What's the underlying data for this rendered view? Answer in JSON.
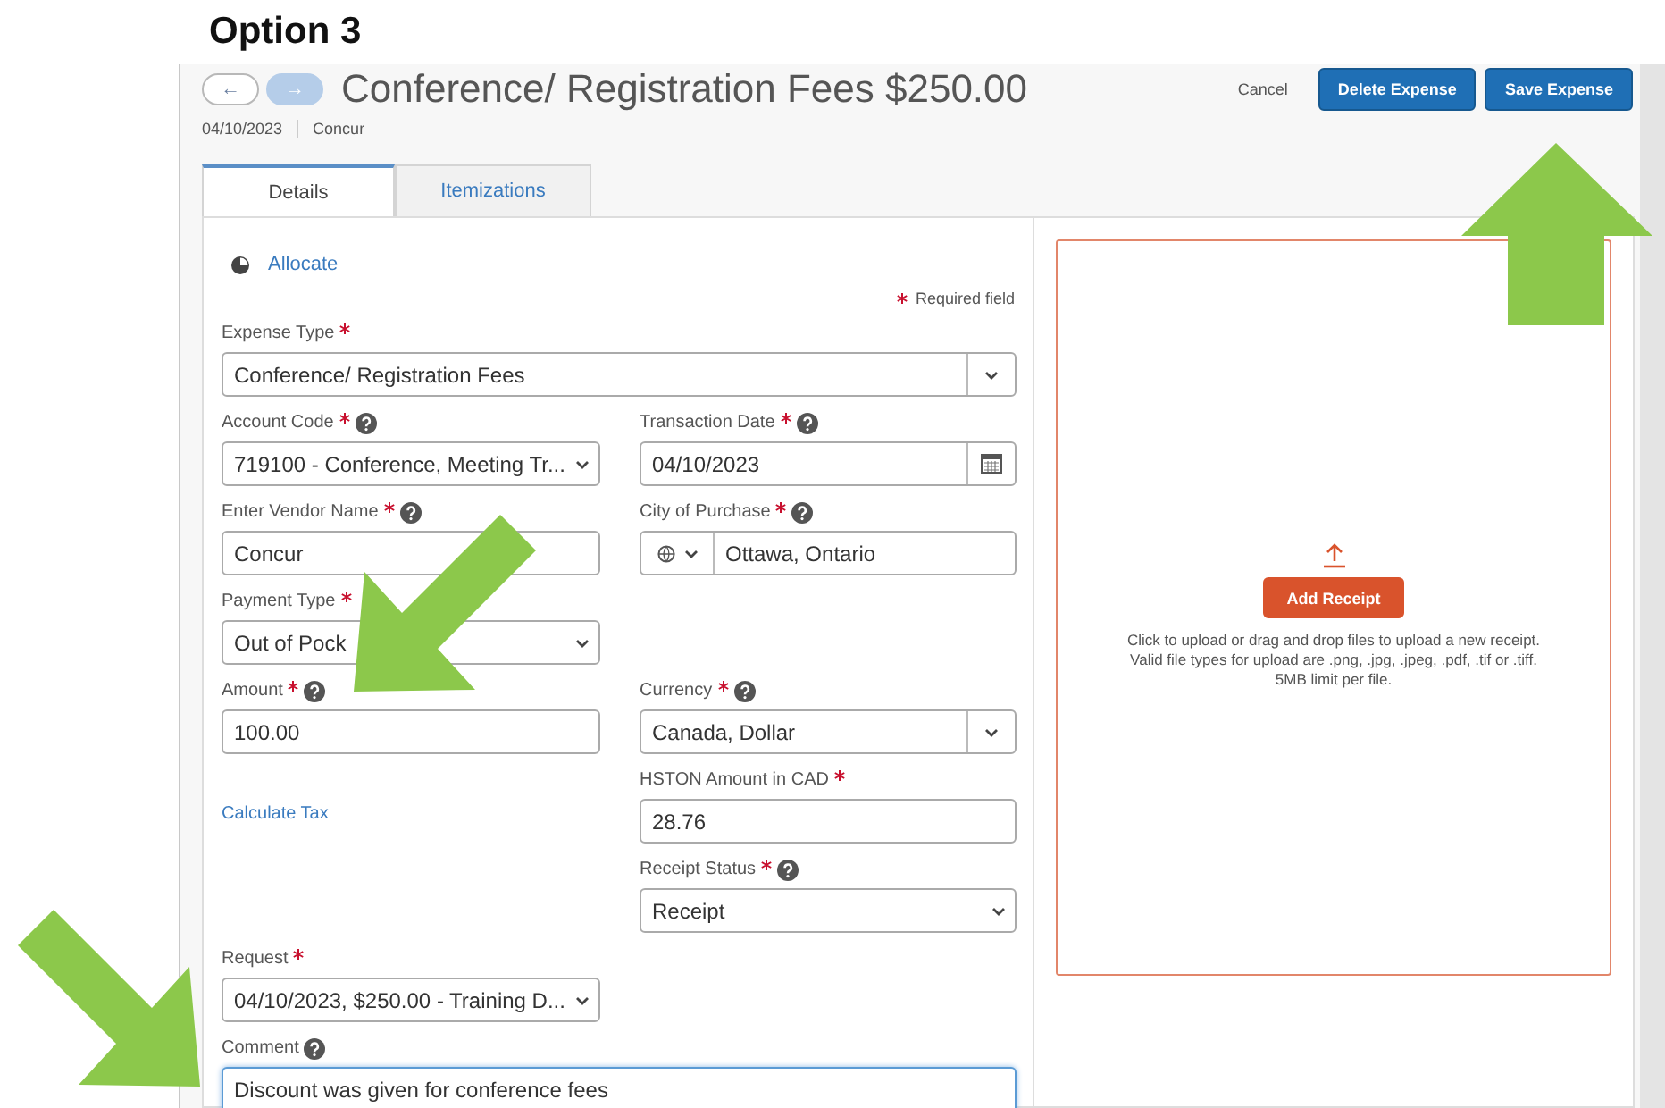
{
  "caption": "Option 3",
  "header": {
    "nav": [
      {
        "label": "←",
        "disabled": false
      },
      {
        "label": "→",
        "disabled": true
      }
    ],
    "title": "Conference/ Registration Fees $250.00",
    "date": "04/10/2023",
    "vendor": "Concur",
    "actions": [
      {
        "label": "Cancel",
        "kind": "link"
      },
      {
        "label": "Delete Expense",
        "kind": "primary"
      },
      {
        "label": "Save Expense",
        "kind": "primary"
      }
    ]
  },
  "tabs": [
    {
      "label": "Details",
      "selected": true
    },
    {
      "label": "Itemizations",
      "selected": false
    }
  ],
  "form": {
    "allocate": "Allocate",
    "required_legend": "Required field",
    "rows": [
      {
        "full": {
          "kind": "combo",
          "label": "Expense Type",
          "required": true,
          "help": false,
          "value": "Conference/ Registration Fees"
        }
      },
      {
        "left": {
          "kind": "select",
          "label": "Account Code",
          "required": true,
          "help": true,
          "value": "719100 - Conference, Meeting Tr..."
        },
        "right": {
          "kind": "date",
          "label": "Transaction Date",
          "required": true,
          "help": true,
          "value": "04/10/2023"
        }
      },
      {
        "left": {
          "kind": "input",
          "label": "Enter Vendor Name",
          "required": true,
          "help": true,
          "value": "Concur"
        },
        "right": {
          "kind": "city",
          "label": "City of Purchase",
          "required": true,
          "help": true,
          "value": "Ottawa, Ontario"
        }
      },
      {
        "left": {
          "kind": "select",
          "label": "Payment Type",
          "required": true,
          "help": false,
          "value": "Out of Pock"
        }
      },
      {
        "left": {
          "kind": "input",
          "label": "Amount",
          "required": true,
          "help": true,
          "value": "100.00"
        },
        "right": {
          "kind": "combo",
          "label": "Currency",
          "required": true,
          "help": true,
          "value": "Canada, Dollar"
        }
      },
      {
        "left": {
          "kind": "link",
          "label": "Calculate Tax"
        },
        "right": {
          "kind": "input",
          "label": "HSTON Amount in CAD",
          "required": true,
          "help": false,
          "value": "28.76"
        }
      },
      {
        "right": {
          "kind": "select",
          "label": "Receipt Status",
          "required": true,
          "help": true,
          "value": "Receipt"
        }
      },
      {
        "left": {
          "kind": "select",
          "label": "Request",
          "required": true,
          "help": false,
          "value": "04/10/2023, $250.00 - Training D..."
        }
      },
      {
        "full": {
          "kind": "textarea",
          "label": "Comment",
          "required": false,
          "help": true,
          "focused": true,
          "value": "Discount was given for conference fees"
        }
      }
    ]
  },
  "receipt": {
    "button": "Add Receipt",
    "lines": [
      "Click to upload or drag and drop files to upload a new receipt.",
      "Valid file types for upload are .png, .jpg, .jpeg, .pdf, .tif or .tiff.",
      "5MB limit per file."
    ]
  },
  "annotations": [
    {
      "kind": "up"
    },
    {
      "kind": "down-left"
    },
    {
      "kind": "down-right"
    }
  ]
}
